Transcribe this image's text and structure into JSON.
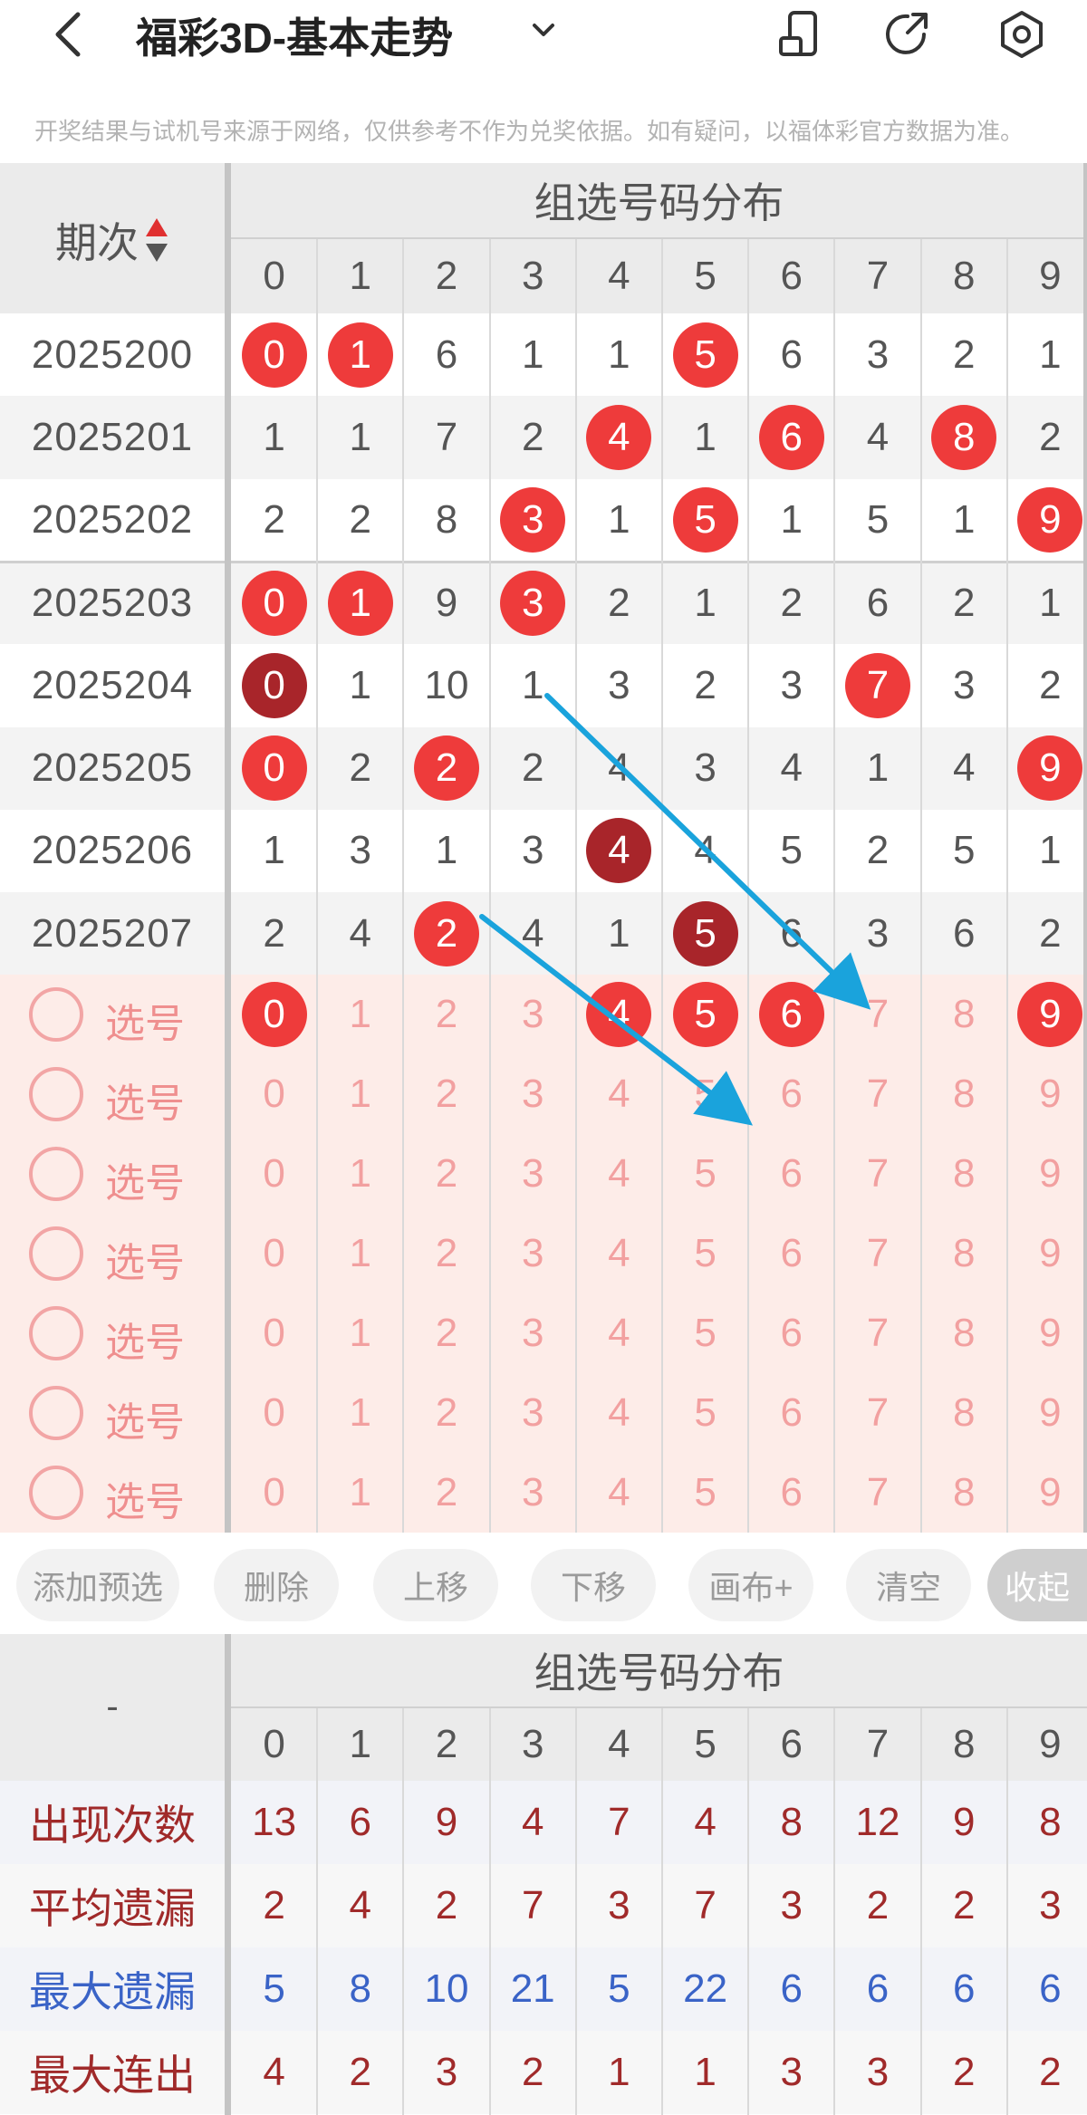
{
  "header": {
    "title": "福彩3D-基本走势",
    "notice": "开奖结果与试机号来源于网络，仅供参考不作为兑奖依据。如有疑问，以福体彩官方数据为准。"
  },
  "main_table": {
    "section_title": "组选号码分布",
    "period_header": "期次",
    "digits": [
      "0",
      "1",
      "2",
      "3",
      "4",
      "5",
      "6",
      "7",
      "8",
      "9"
    ],
    "rows": [
      {
        "period": "2025200",
        "cells": [
          "0",
          "1",
          "6",
          "1",
          "1",
          "5",
          "6",
          "3",
          "2",
          "1"
        ],
        "balls": [
          0,
          1,
          5
        ],
        "dark": []
      },
      {
        "period": "2025201",
        "cells": [
          "1",
          "1",
          "7",
          "2",
          "4",
          "1",
          "6",
          "4",
          "8",
          "2"
        ],
        "balls": [
          4,
          6,
          8
        ],
        "dark": []
      },
      {
        "period": "2025202",
        "cells": [
          "2",
          "2",
          "8",
          "3",
          "1",
          "5",
          "1",
          "5",
          "1",
          "9"
        ],
        "balls": [
          3,
          5,
          9
        ],
        "dark": []
      },
      {
        "period": "2025203",
        "cells": [
          "0",
          "1",
          "9",
          "3",
          "2",
          "1",
          "2",
          "6",
          "2",
          "1"
        ],
        "balls": [
          0,
          1,
          3
        ],
        "dark": []
      },
      {
        "period": "2025204",
        "cells": [
          "0",
          "1",
          "10",
          "1",
          "3",
          "2",
          "3",
          "7",
          "3",
          "2"
        ],
        "balls": [
          7
        ],
        "dark": [
          0
        ]
      },
      {
        "period": "2025205",
        "cells": [
          "0",
          "2",
          "2",
          "2",
          "4",
          "3",
          "4",
          "1",
          "4",
          "9"
        ],
        "balls": [
          0,
          2,
          9
        ],
        "dark": []
      },
      {
        "period": "2025206",
        "cells": [
          "1",
          "3",
          "1",
          "3",
          "4",
          "4",
          "5",
          "2",
          "5",
          "1"
        ],
        "balls": [],
        "dark": [
          4
        ]
      },
      {
        "period": "2025207",
        "cells": [
          "2",
          "4",
          "2",
          "4",
          "1",
          "5",
          "6",
          "3",
          "6",
          "2"
        ],
        "balls": [
          2
        ],
        "dark": [
          5
        ]
      }
    ],
    "pick_label": "选号",
    "pick_rows": [
      {
        "balls": [
          0,
          4,
          5,
          6,
          9
        ]
      },
      {
        "balls": []
      },
      {
        "balls": []
      },
      {
        "balls": []
      },
      {
        "balls": []
      },
      {
        "balls": []
      },
      {
        "balls": []
      }
    ]
  },
  "actions": {
    "add": "添加预选",
    "delete": "删除",
    "up": "上移",
    "down": "下移",
    "canvas": "画布+",
    "clear": "清空",
    "collapse": "收起"
  },
  "stats_table": {
    "section_title": "组选号码分布",
    "corner": "-",
    "digits": [
      "0",
      "1",
      "2",
      "3",
      "4",
      "5",
      "6",
      "7",
      "8",
      "9"
    ],
    "rows": [
      {
        "label": "出现次数",
        "values": [
          "13",
          "6",
          "9",
          "4",
          "7",
          "4",
          "8",
          "12",
          "9",
          "8"
        ],
        "color": "#a02a2a"
      },
      {
        "label": "平均遗漏",
        "values": [
          "2",
          "4",
          "2",
          "7",
          "3",
          "7",
          "3",
          "2",
          "2",
          "3"
        ],
        "color": "#a02a2a"
      },
      {
        "label": "最大遗漏",
        "values": [
          "5",
          "8",
          "10",
          "21",
          "5",
          "22",
          "6",
          "6",
          "6",
          "6"
        ],
        "color": "#3a63c7"
      },
      {
        "label": "最大连出",
        "values": [
          "4",
          "2",
          "3",
          "2",
          "1",
          "1",
          "3",
          "3",
          "2",
          "2"
        ],
        "color": "#a02a2a"
      }
    ]
  },
  "colors": {
    "ball_red": "#ee3b3b",
    "ball_dark": "#a8252a",
    "pick_bg": "#fdece8",
    "arrow": "#1aa3dc"
  }
}
